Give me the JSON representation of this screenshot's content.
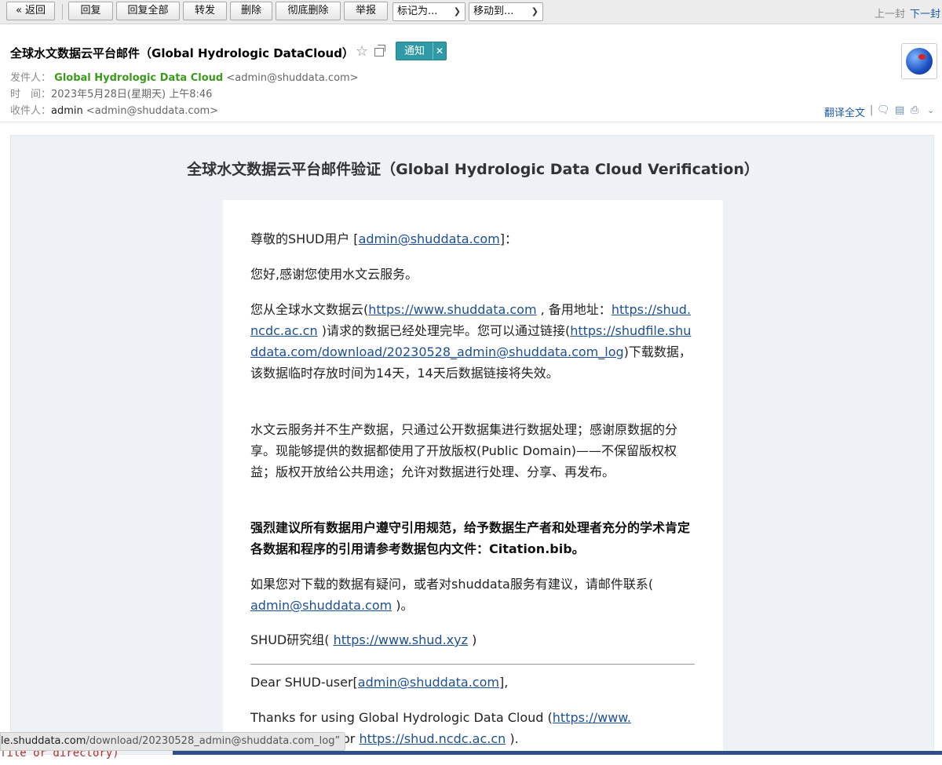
{
  "toolbar": {
    "back": "« 返回",
    "reply": "回复",
    "reply_all": "回复全部",
    "forward": "转发",
    "delete": "删除",
    "delete_forever": "彻底删除",
    "report": "举报",
    "mark_as": "标记为...",
    "move_to": "移动到...",
    "prev": "上一封",
    "next": "下一封"
  },
  "header": {
    "subject": "全球水文数据云平台邮件（Global Hydrologic DataCloud）",
    "tag": "通知",
    "from_label": "发件人：",
    "from_name": "Global Hydrologic Data Cloud",
    "from_addr": "<admin@shuddata.com>",
    "time_label": "时　间：",
    "time_value": "2023年5月28日(星期天) 上午8:46",
    "to_label": "收件人：",
    "to_name": "admin",
    "to_addr": "<admin@shuddata.com>",
    "translate": "翻译全文"
  },
  "mail": {
    "title": "全球水文数据云平台邮件验证（Global Hydrologic Data Cloud Verification）",
    "greeting_prefix": "尊敬的SHUD用户 [",
    "greeting_email": "admin@shuddata.com",
    "greeting_suffix": "]：",
    "hello": "您好,感谢您使用水文云服务。",
    "p3_a": "您从全球水文数据云(",
    "p3_link1": "https://www.shuddata.com",
    "p3_b": " , 备用地址：",
    "p3_link2": "https://shud.ncdc.ac.cn",
    "p3_c": " )请求的数据已经处理完毕。您可以通过链接(",
    "p3_link3": "https://shudfile.shuddata.com/download/20230528_admin@shuddata.com_log",
    "p3_d": ")下载数据，该数据临时存放时间为14天，14天后数据链接将失效。",
    "p4": "水文云服务并不生产数据，只通过公开数据集进行数据处理；感谢原数据的分享。现能够提供的数据都使用了开放版权(Public Domain)——不保留版权权益；版权开放给公共用途；允许对数据进行处理、分享、再发布。",
    "p5": "强烈建议所有数据用户遵守引用规范，给予数据生产者和处理者充分的学术肯定各数据和程序的引用请参考数据包内文件：Citation.bib。",
    "p6_a": "如果您对下载的数据有疑问，或者对shuddata服务有建议，请邮件联系( ",
    "p6_link": "admin@shuddata.com",
    "p6_b": " )。",
    "p7_a": "SHUD研究组( ",
    "p7_link": "https://www.shud.xyz",
    "p7_b": " )",
    "en_greeting_a": "Dear SHUD-user[",
    "en_greeting_link": "admin@shuddata.com",
    "en_greeting_b": "],",
    "en_p1_a": "Thanks for using Global Hydrologic Data Cloud (",
    "en_p1_link1_line1": "https://www.",
    "en_p1_b": " or ",
    "en_p1_link2": "https://shud.ncdc.ac.cn",
    "en_p1_c": " )."
  },
  "statusbar": {
    "host": "le.shuddata.com",
    "path": "/download/20230528_admin@shuddata.com_log”"
  },
  "underlay_text": "file or directory)"
}
